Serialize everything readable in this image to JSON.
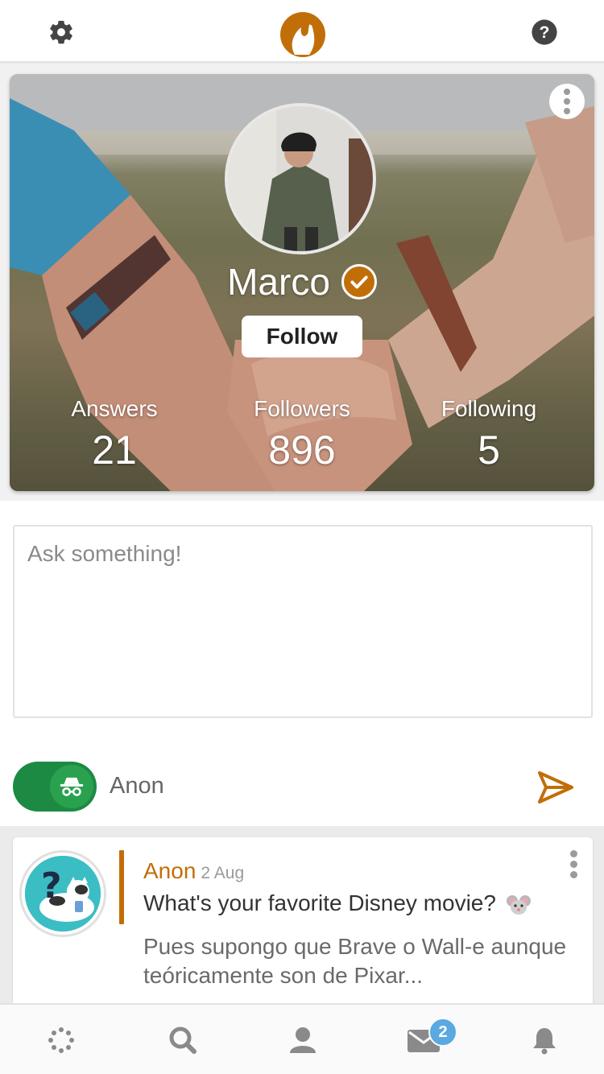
{
  "topbar": {
    "settings_icon": "gear-icon",
    "logo_icon": "flame-logo-icon",
    "help_icon": "question-circle-icon",
    "brand_color": "#c26e08"
  },
  "profile": {
    "name": "Marco",
    "verified": true,
    "follow_label": "Follow",
    "stats": [
      {
        "label": "Answers",
        "value": "21"
      },
      {
        "label": "Followers",
        "value": "896"
      },
      {
        "label": "Following",
        "value": "5"
      }
    ]
  },
  "ask": {
    "placeholder": "Ask something!",
    "anon_label": "Anon",
    "anon_enabled": true,
    "anon_color": "#1c8a42",
    "send_icon": "send-icon"
  },
  "feed": {
    "items": [
      {
        "author": "Anon",
        "date": "2 Aug",
        "question": "What's your favorite Disney movie?",
        "question_emoji": "mouse-face-emoji",
        "answer": "Pues supongo que Brave o Wall-e aunque teóricamente son de Pixar..."
      }
    ]
  },
  "nav": {
    "items": [
      "home-icon",
      "search-icon",
      "profile-icon",
      "inbox-icon",
      "notifications-icon"
    ],
    "inbox_badge": "2",
    "badge_color": "#5aa9e0"
  }
}
